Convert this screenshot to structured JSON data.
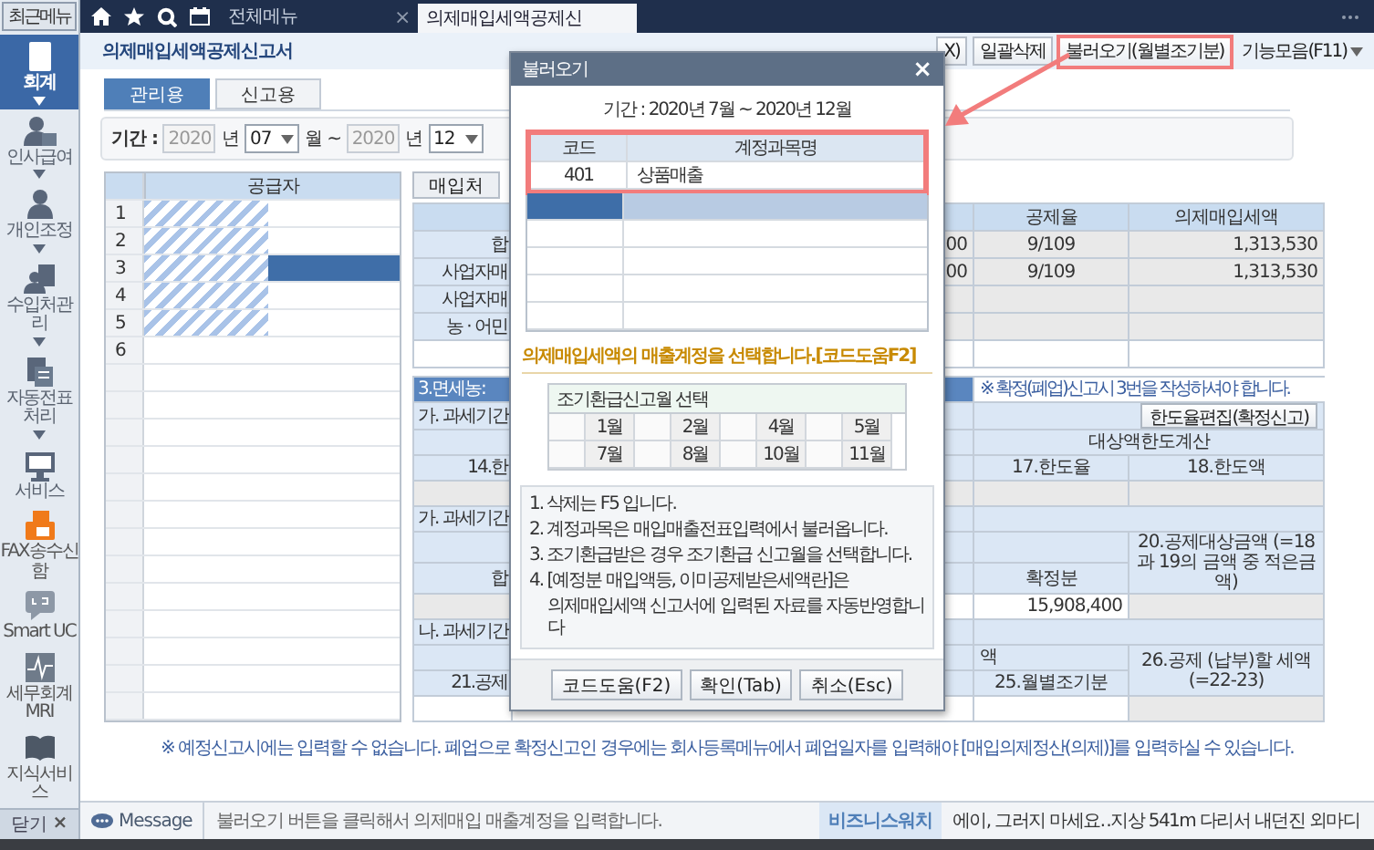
{
  "sidebar": {
    "recent_button": "최근메뉴",
    "items": [
      {
        "label": "회계",
        "selected": true,
        "expandable": true
      },
      {
        "label": "인사급여",
        "selected": false,
        "expandable": true
      },
      {
        "label": "개인조정",
        "selected": false,
        "expandable": true
      },
      {
        "label": "수입처관리",
        "selected": false,
        "expandable": true
      },
      {
        "label": "자동전표처리",
        "selected": false,
        "expandable": true
      },
      {
        "label": "서비스",
        "selected": false,
        "expandable": false
      }
    ],
    "tools": [
      {
        "label": "FAX송수신함"
      },
      {
        "label": "Smart UC"
      },
      {
        "label": "세무회계MRI"
      },
      {
        "label": "지식서비스"
      }
    ],
    "close_button": {
      "label": "닫기",
      "icon": "×"
    }
  },
  "topbar": {
    "menu_label": "전체메뉴",
    "tabs": [
      {
        "label": "의제매입세액공제신",
        "close": "×",
        "selected": true
      }
    ]
  },
  "form": {
    "title": "의제매입세액공제신고서",
    "toolbar": [
      {
        "label": "X)",
        "kind": "button",
        "highlighted": false
      },
      {
        "label": "일괄삭제",
        "kind": "button",
        "highlighted": false
      },
      {
        "label": "불러오기(월별조기분)",
        "kind": "button",
        "highlighted": true
      },
      {
        "label": "기능모음(F11)",
        "kind": "dropdown",
        "highlighted": false
      }
    ],
    "view_tabs": [
      {
        "label": "관리용",
        "selected": true
      },
      {
        "label": "신고용",
        "selected": false
      }
    ],
    "period": {
      "label": "기간 :",
      "from_year": "2020",
      "from_year_unit": "년",
      "from_month": "07",
      "range_sep": "월 ~",
      "to_year": "2020",
      "to_year_unit": "년",
      "to_month": "12"
    },
    "supplier_grid": {
      "header": "공급자",
      "rows": [
        {
          "no": "1",
          "selected": false,
          "redacted": true
        },
        {
          "no": "2",
          "selected": false,
          "redacted": true
        },
        {
          "no": "3",
          "selected": true,
          "redacted": true
        },
        {
          "no": "4",
          "selected": false,
          "redacted": true
        },
        {
          "no": "5",
          "selected": false,
          "redacted": true
        },
        {
          "no": "6",
          "selected": false,
          "redacted": false
        }
      ]
    },
    "purchase_tab": "매입처",
    "deduction_table": {
      "columns": [
        "공제율",
        "의제매입세액"
      ],
      "rows": [
        {
          "label": "합",
          "column_2": "00",
          "rate": "9/109",
          "amount": "1,313,530"
        },
        {
          "label": "사업자매",
          "column_2": "00",
          "rate": "9/109",
          "amount": "1,313,530"
        },
        {
          "label": "사업자매"
        },
        {
          "label": "농 · 어민"
        }
      ]
    },
    "confirm_note": "※ 확정(폐업)신고시 3번을 작성하셔야 합니다.",
    "limit_section": {
      "header": "3.면세농:",
      "period_a": "가. 과세기간",
      "edit_button": "한도율편집(확정신고)",
      "limit_calc": "대상액한도계산",
      "item_14": "14.한",
      "limit_rate": "17.한도율",
      "limit_amount": "18.한도액",
      "period_a2": "가. 과세기간",
      "total": "합",
      "deductible": "20.공제대상금액 (=18과 19의 금액 중 적은금액)",
      "final": "확정분",
      "final_amount": "15,908,400",
      "period_b": "나. 과세기간",
      "amount_partial": "액",
      "item_21": "21.공제",
      "monthly_early": "25.월별조기분",
      "payable": "26.공제 (납부)할 세액(=22-23)"
    },
    "bottom_note": "※ 예정신고시에는 입력할 수 없습니다. 폐업으로 확정신고인 경우에는 회사등록메뉴에서 폐업일자를 입력해야 [매입의제정산(의제)]를 입력하실 수 있습니다."
  },
  "status": {
    "label": "Message",
    "message": "불러오기 버튼을 클릭해서 의제매입 매출계정을 입력합니다.",
    "news_source": "비즈니스워치",
    "news_headline": "에이, 그러지 마세요‥지상 541m 다리서 내던진 외마디"
  },
  "dialog": {
    "title": "불러오기",
    "close": "×",
    "period": "기간 : 2020년 7월 ~ 2020년 12월",
    "table": {
      "columns": [
        "코드",
        "계정과목명"
      ],
      "highlighted": true,
      "rows": [
        {
          "code": "401",
          "name": "상품매출",
          "selected": false
        },
        {
          "selected": true
        }
      ]
    },
    "instruction": "의제매입세액의 매출계정을 선택합니다.[코드도움F2]",
    "early_refund": {
      "title": "조기환급신고월 선택",
      "months": [
        {
          "label": "1월",
          "checked": false
        },
        {
          "label": "2월",
          "checked": false
        },
        {
          "label": "4월",
          "checked": false
        },
        {
          "label": "5월",
          "checked": false
        },
        {
          "label": "7월",
          "checked": false
        },
        {
          "label": "8월",
          "checked": false
        },
        {
          "label": "10월",
          "checked": false
        },
        {
          "label": "11월",
          "checked": false
        }
      ]
    },
    "notes": [
      {
        "text": "1. 삭제는 F5 입니다."
      },
      {
        "text": "2. 계정과목은 매입매출전표입력에서 불러옵니다."
      },
      {
        "text": "3. 조기환급받은 경우 조기환급 신고월을 선택합니다."
      },
      {
        "text": "4. [예정분 매입액등, 이미공제받은세액란]은",
        "continuation": "의제매입세액 신고서에 입력된 자료를 자동반영합니다"
      }
    ],
    "buttons": [
      "코드도움(F2)",
      "확인(Tab)",
      "취소(Esc)"
    ]
  },
  "annotation": {
    "callout_arrow": true
  }
}
